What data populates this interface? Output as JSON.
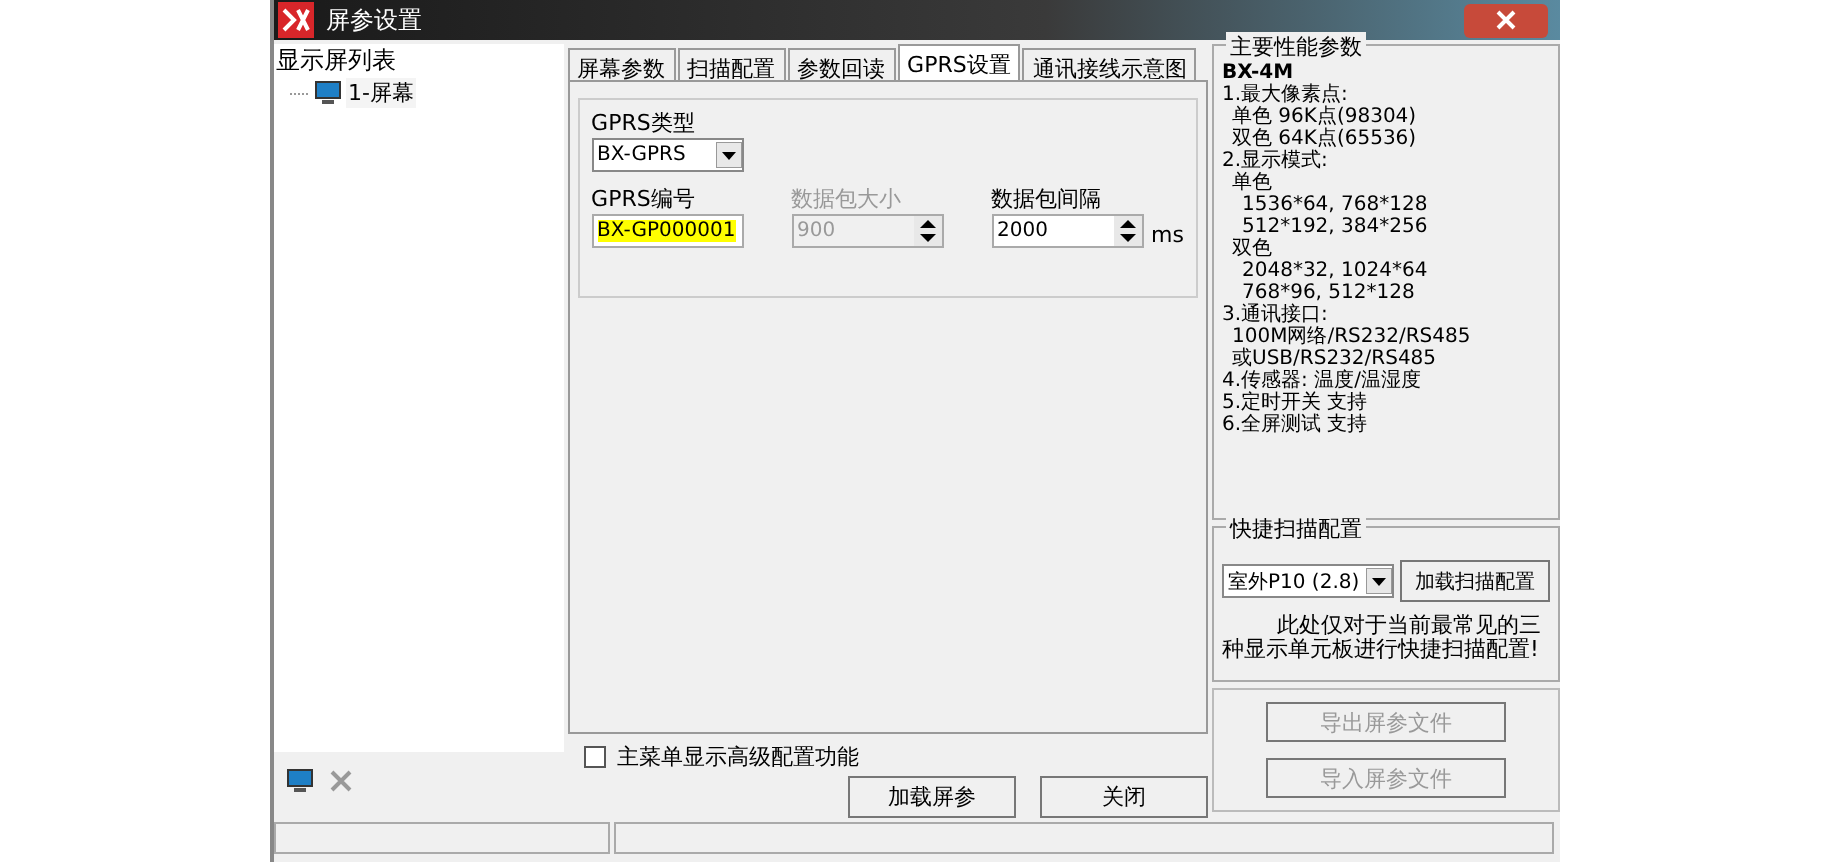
{
  "window": {
    "title": "屏参设置"
  },
  "screen_list": {
    "title": "显示屏列表",
    "items": [
      {
        "label": "1-屏幕",
        "selected": false
      }
    ]
  },
  "tabs": [
    {
      "label": "屏幕参数",
      "selected": false
    },
    {
      "label": "扫描配置",
      "selected": false
    },
    {
      "label": "参数回读",
      "selected": false
    },
    {
      "label": "GPRS设置",
      "selected": true
    },
    {
      "label": "通讯接线示意图",
      "selected": false
    }
  ],
  "gprs": {
    "type_label": "GPRS类型",
    "type_value": "BX-GPRS",
    "id_label": "GPRS编号",
    "id_value": "BX-GP000001",
    "size_label": "数据包大小",
    "size_value": "900",
    "size_disabled": true,
    "interval_label": "数据包间隔",
    "interval_value": "2000",
    "interval_unit": "ms"
  },
  "advanced_checkbox": {
    "label": "主菜单显示高级配置功能",
    "checked": false
  },
  "buttons": [
    {
      "label": "加载屏参",
      "disabled": false
    },
    {
      "label": "关闭",
      "disabled": false
    }
  ],
  "specs": {
    "title": "主要性能参数",
    "model": "BX-4M",
    "items": [
      {
        "text": "1.最大像素点:",
        "children": [
          {
            "text": "单色 96K点(98304)"
          },
          {
            "text": "双色 64K点(65536)"
          }
        ]
      },
      {
        "text": "2.显示模式:",
        "children": [
          {
            "text": "单色",
            "children": [
              {
                "text": "1536*64, 768*128"
              },
              {
                "text": "512*192, 384*256"
              }
            ]
          },
          {
            "text": "双色",
            "children": [
              {
                "text": "2048*32, 1024*64"
              },
              {
                "text": "768*96, 512*128"
              }
            ]
          }
        ]
      },
      {
        "text": "3.通讯接口:",
        "children": [
          {
            "text": "100M网络/RS232/RS485"
          },
          {
            "text": "或USB/RS232/RS485"
          }
        ]
      },
      {
        "text": "4.传感器: 温度/温湿度"
      },
      {
        "text": "5.定时开关 支持"
      },
      {
        "text": "6.全屏测试 支持"
      }
    ]
  },
  "quick_scan": {
    "title": "快捷扫描配置",
    "select_value": "室外P10 (2.8)",
    "button": "加载扫描配置",
    "note": "此处仅对于当前最常见的三种显示单元板进行快捷扫描配置!"
  },
  "file_buttons": [
    {
      "label": "导出屏参文件",
      "disabled": true
    },
    {
      "label": "导入屏参文件",
      "disabled": true
    }
  ]
}
